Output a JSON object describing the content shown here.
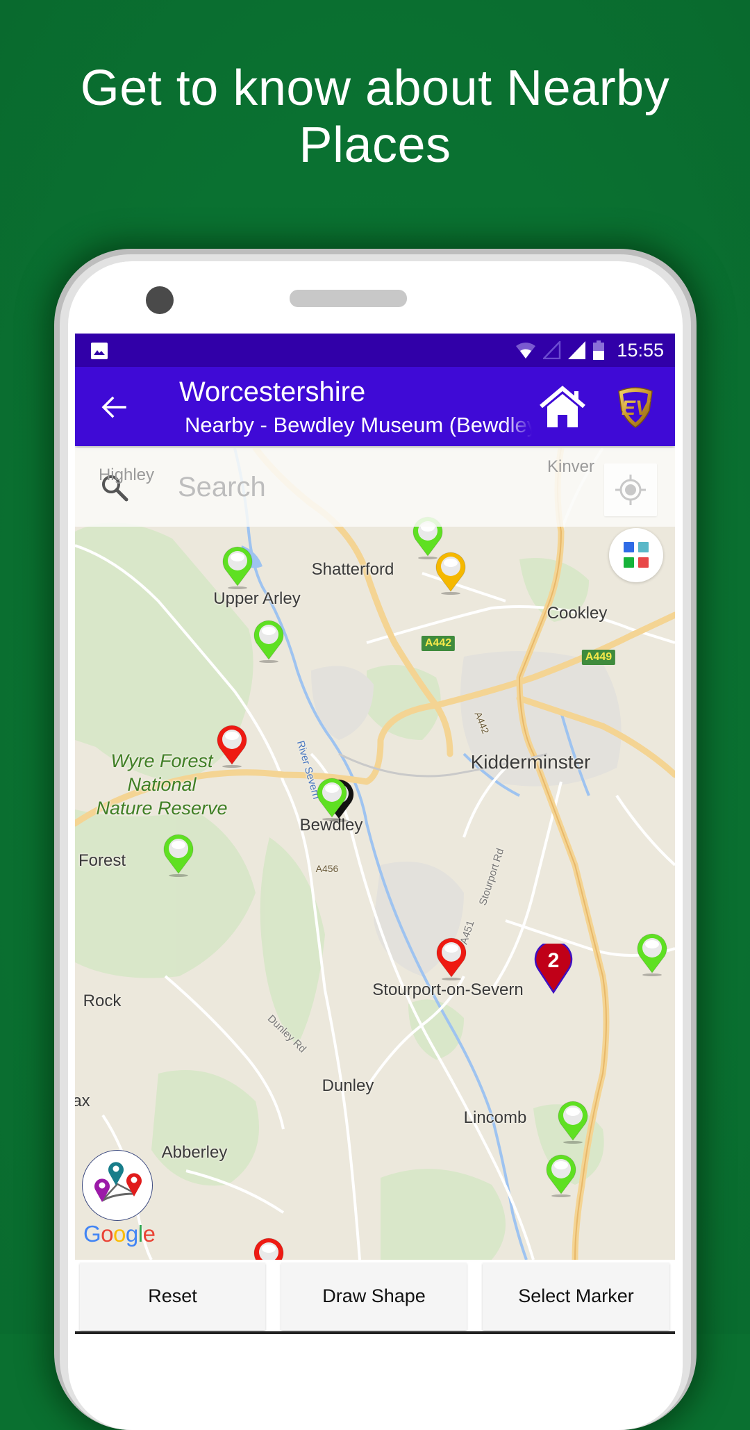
{
  "promo": {
    "headline_line1": "Get to know about Nearby",
    "headline_line2": "Places",
    "background_color": "#0a7030"
  },
  "status_bar": {
    "time": "15:55",
    "icons": [
      "image-notification-icon",
      "wifi-icon",
      "signal-empty-icon",
      "signal-full-icon",
      "battery-icon"
    ],
    "color": "#3100a8"
  },
  "toolbar": {
    "title": "Worcestershire",
    "subtitle": "Nearby - Bewdley Museum (Bewdley)",
    "back_icon": "arrow-left-icon",
    "home_icon": "home-icon",
    "logo": "EV",
    "color": "#3f0ad6"
  },
  "search": {
    "placeholder": "Search",
    "value": ""
  },
  "map": {
    "place_labels": {
      "highley": "Highley",
      "kinver": "Kinver",
      "shatterford": "Shatterford",
      "upper_arley": "Upper Arley",
      "cookley": "Cookley",
      "kidderminster": "Kidderminster",
      "wyre1": "Wyre Forest",
      "wyre2": "National",
      "wyre3": "Nature Reserve",
      "bewdley": "Bewdley",
      "forest": "Forest",
      "stourport": "Stourport-on-Severn",
      "rock": "Rock",
      "dunley": "Dunley",
      "ax": "ax",
      "lincomb": "Lincomb",
      "abberley": "Abberley"
    },
    "road_labels": {
      "a442_shield": "A442",
      "a449_shield": "A449",
      "a442_road": "A442",
      "a456": "A456",
      "stourport_rd": "Stourport Rd",
      "a451": "A451",
      "dunley_rd": "Dunley Rd",
      "river_severn": "River Severn"
    },
    "markers": [
      {
        "color": "green",
        "near": "Upper Arley"
      },
      {
        "color": "green",
        "near": "Shatterford north"
      },
      {
        "color": "yellow",
        "near": "Shatterford"
      },
      {
        "color": "green",
        "near": "Trimpley Reservoir"
      },
      {
        "color": "red",
        "near": "Wyre Forest"
      },
      {
        "color": "black",
        "near": "Bewdley",
        "selected": true
      },
      {
        "color": "green",
        "near": "Bewdley"
      },
      {
        "color": "green",
        "near": "Forest"
      },
      {
        "color": "red",
        "near": "Stourport-on-Severn"
      },
      {
        "color": "green",
        "near": "east edge"
      },
      {
        "color": "green",
        "near": "Lincomb"
      },
      {
        "color": "green",
        "near": "south of Lincomb"
      },
      {
        "color": "red",
        "near": "bottom"
      }
    ],
    "cluster": {
      "count": "2",
      "color": "#c00018"
    },
    "layer_button_colors": [
      "#2f6be6",
      "#5ab8c8",
      "#16b33a",
      "#e84848"
    ],
    "attribution": "Google"
  },
  "buttons": {
    "reset": "Reset",
    "draw_shape": "Draw Shape",
    "select_marker": "Select Marker"
  }
}
